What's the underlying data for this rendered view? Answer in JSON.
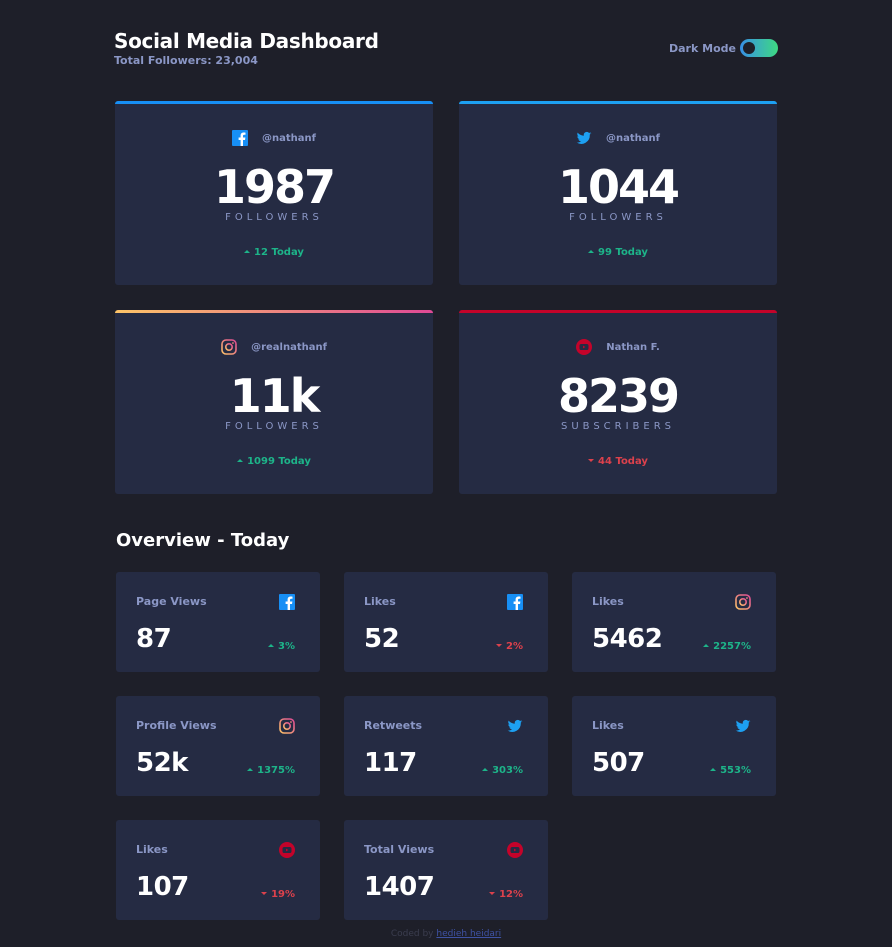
{
  "header": {
    "title": "Social Media Dashboard",
    "total_followers": "Total Followers: 23,004",
    "dark_mode_label": "Dark Mode",
    "dark_mode_on": true
  },
  "colors": {
    "background": "#1e1f29",
    "card": "#252b43",
    "facebook": "#178ff5",
    "twitter": "#1da0f2",
    "instagram_start": "#fdc468",
    "instagram_end": "#df4996",
    "youtube": "#c4032a",
    "up": "#1db489",
    "down": "#dc414c"
  },
  "followers": [
    {
      "platform": "facebook",
      "icon": "facebook-icon",
      "handle": "@nathanf",
      "count": "1987",
      "unit": "FOLLOWERS",
      "delta": "12 Today",
      "trend": "up"
    },
    {
      "platform": "twitter",
      "icon": "twitter-icon",
      "handle": "@nathanf",
      "count": "1044",
      "unit": "FOLLOWERS",
      "delta": "99 Today",
      "trend": "up"
    },
    {
      "platform": "instagram",
      "icon": "instagram-icon",
      "handle": "@realnathanf",
      "count": "11k",
      "unit": "FOLLOWERS",
      "delta": "1099 Today",
      "trend": "up"
    },
    {
      "platform": "youtube",
      "icon": "youtube-icon",
      "handle": "Nathan F.",
      "count": "8239",
      "unit": "SUBSCRIBERS",
      "delta": "44 Today",
      "trend": "down"
    }
  ],
  "overview": {
    "title": "Overview - Today",
    "cards": [
      {
        "metric": "Page Views",
        "platform": "facebook",
        "value": "87",
        "pct": "3%",
        "trend": "up"
      },
      {
        "metric": "Likes",
        "platform": "facebook",
        "value": "52",
        "pct": "2%",
        "trend": "down"
      },
      {
        "metric": "Likes",
        "platform": "instagram",
        "value": "5462",
        "pct": "2257%",
        "trend": "up"
      },
      {
        "metric": "Profile Views",
        "platform": "instagram",
        "value": "52k",
        "pct": "1375%",
        "trend": "up"
      },
      {
        "metric": "Retweets",
        "platform": "twitter",
        "value": "117",
        "pct": "303%",
        "trend": "up"
      },
      {
        "metric": "Likes",
        "platform": "twitter",
        "value": "507",
        "pct": "553%",
        "trend": "up"
      },
      {
        "metric": "Likes",
        "platform": "youtube",
        "value": "107",
        "pct": "19%",
        "trend": "down"
      },
      {
        "metric": "Total Views",
        "platform": "youtube",
        "value": "1407",
        "pct": "12%",
        "trend": "down"
      }
    ]
  },
  "footer": {
    "prefix": "Coded by",
    "author": "hedieh heidari"
  }
}
